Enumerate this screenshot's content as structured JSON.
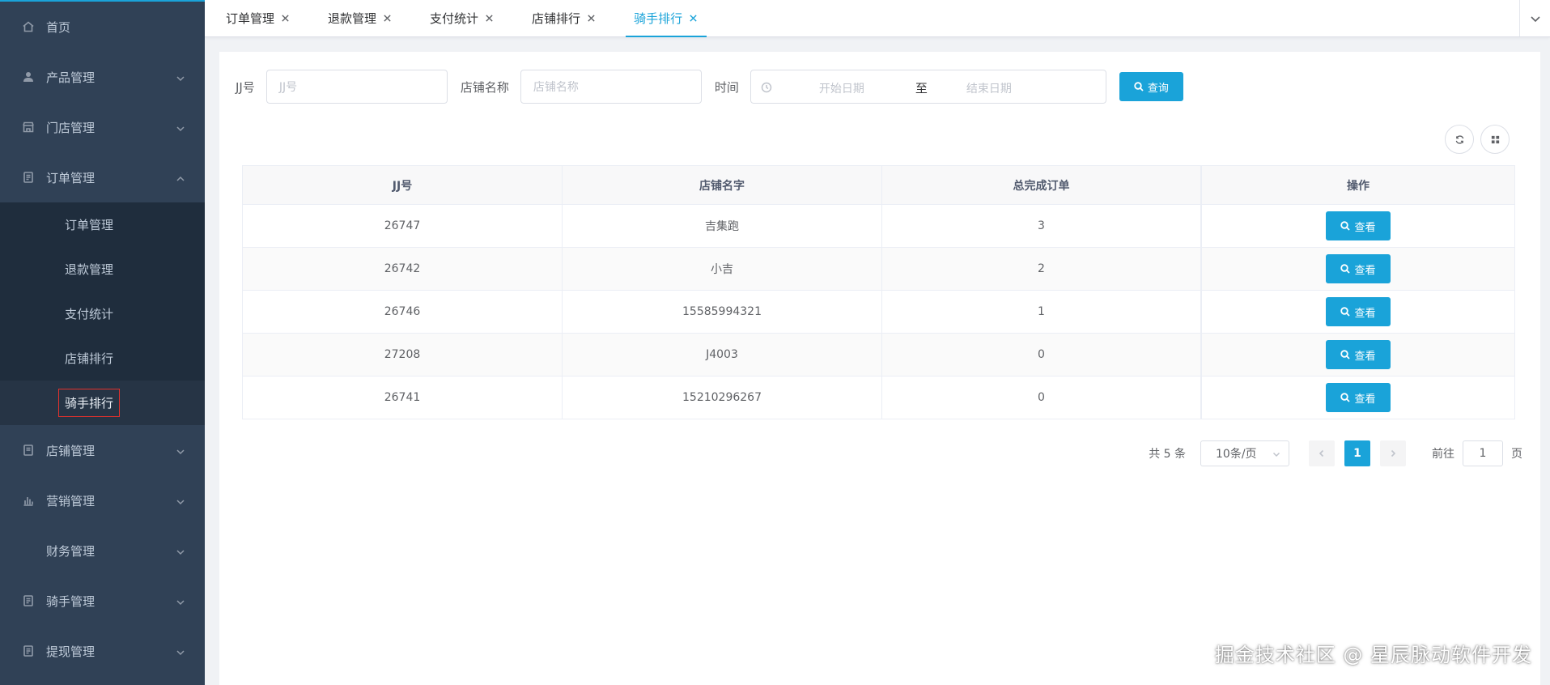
{
  "sidebar": {
    "items": [
      {
        "label": "首页",
        "icon": "home-icon"
      },
      {
        "label": "产品管理",
        "icon": "user-icon"
      },
      {
        "label": "门店管理",
        "icon": "store-icon"
      },
      {
        "label": "订单管理",
        "icon": "order-icon"
      },
      {
        "label": "店铺管理",
        "icon": "shop-icon"
      },
      {
        "label": "营销管理",
        "icon": "chart-icon"
      },
      {
        "label": "财务管理",
        "icon": ""
      },
      {
        "label": "骑手管理",
        "icon": "rider-icon"
      },
      {
        "label": "提现管理",
        "icon": "withdraw-icon"
      }
    ],
    "order_submenu": [
      "订单管理",
      "退款管理",
      "支付统计",
      "店铺排行",
      "骑手排行"
    ]
  },
  "tabs": [
    {
      "label": "订单管理"
    },
    {
      "label": "退款管理"
    },
    {
      "label": "支付统计"
    },
    {
      "label": "店铺排行"
    },
    {
      "label": "骑手排行"
    }
  ],
  "filters": {
    "jj_label": "JJ号",
    "jj_placeholder": "JJ号",
    "shop_label": "店铺名称",
    "shop_placeholder": "店铺名称",
    "time_label": "时间",
    "start_placeholder": "开始日期",
    "range_separator": "至",
    "end_placeholder": "结束日期",
    "search_label": "查询"
  },
  "table": {
    "headers": [
      "JJ号",
      "店铺名字",
      "总完成订单",
      "操作"
    ],
    "rows": [
      {
        "jj": "26747",
        "shop": "吉集跑",
        "orders": "3",
        "action": "查看"
      },
      {
        "jj": "26742",
        "shop": "小吉",
        "orders": "2",
        "action": "查看"
      },
      {
        "jj": "26746",
        "shop": "15585994321",
        "orders": "1",
        "action": "查看"
      },
      {
        "jj": "27208",
        "shop": "J4003",
        "orders": "0",
        "action": "查看"
      },
      {
        "jj": "26741",
        "shop": "15210296267",
        "orders": "0",
        "action": "查看"
      }
    ]
  },
  "pagination": {
    "total": "共 5 条",
    "page_size": "10条/页",
    "current": "1",
    "goto_label": "前往",
    "goto_value": "1",
    "page_suffix": "页"
  },
  "watermark": "掘金技术社区 @ 星辰脉动软件开发",
  "colors": {
    "accent": "#1aa3d9",
    "sidebar_bg": "#304156",
    "submenu_bg": "#1f2d3d",
    "active_outline": "#e2312c"
  }
}
